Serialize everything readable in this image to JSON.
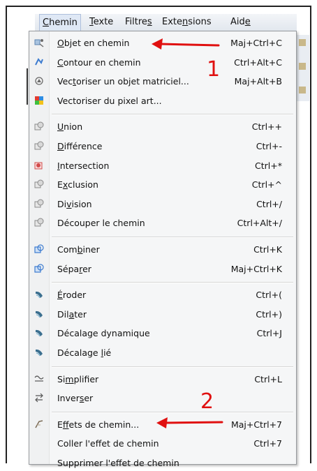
{
  "menubar": {
    "items": [
      {
        "label": "Chemin",
        "ul": 0
      },
      {
        "label": "Texte",
        "ul": 0
      },
      {
        "label": "Filtres",
        "ul": 6
      },
      {
        "label": "Extensions",
        "ul": 4
      },
      {
        "label": "Aide",
        "ul": 3
      }
    ]
  },
  "menu": {
    "items": [
      {
        "type": "item",
        "pre": "",
        "ul": "O",
        "post": "bjet en chemin",
        "acc": "Maj+Ctrl+C",
        "icon": "object-to-path-icon",
        "icolor": "#5b84b1"
      },
      {
        "type": "item",
        "pre": "",
        "ul": "C",
        "post": "ontour en chemin",
        "acc": "Ctrl+Alt+C",
        "icon": "stroke-to-path-icon",
        "icolor": "#3d7cd0"
      },
      {
        "type": "item",
        "pre": "Vec",
        "ul": "t",
        "post": "oriser un objet matriciel...",
        "acc": "Maj+Alt+B",
        "icon": "trace-bitmap-icon",
        "icolor": "#6a6a6a"
      },
      {
        "type": "item",
        "pre": "Vectoriser du pixel art...",
        "ul": "",
        "post": "",
        "acc": "",
        "icon": "trace-pixel-art-icon",
        "icolor": "#e23b2e"
      },
      {
        "type": "sep"
      },
      {
        "type": "item",
        "pre": "",
        "ul": "U",
        "post": "nion",
        "acc": "Ctrl++",
        "icon": "union-icon",
        "icolor": "#8a8a8a"
      },
      {
        "type": "item",
        "pre": "",
        "ul": "D",
        "post": "ifférence",
        "acc": "Ctrl+-",
        "icon": "difference-icon",
        "icolor": "#8a8a8a"
      },
      {
        "type": "item",
        "pre": "",
        "ul": "I",
        "post": "ntersection",
        "acc": "Ctrl+*",
        "icon": "intersection-icon",
        "icolor": "#d24b4b"
      },
      {
        "type": "item",
        "pre": "E",
        "ul": "x",
        "post": "clusion",
        "acc": "Ctrl+^",
        "icon": "exclusion-icon",
        "icolor": "#8a8a8a"
      },
      {
        "type": "item",
        "pre": "Di",
        "ul": "v",
        "post": "ision",
        "acc": "Ctrl+/",
        "icon": "division-icon",
        "icolor": "#8a8a8a"
      },
      {
        "type": "item",
        "pre": "Découper le chemin",
        "ul": "",
        "post": "",
        "acc": "Ctrl+Alt+/",
        "icon": "cut-path-icon",
        "icolor": "#8a8a8a"
      },
      {
        "type": "sep"
      },
      {
        "type": "item",
        "pre": "Com",
        "ul": "b",
        "post": "iner",
        "acc": "Ctrl+K",
        "icon": "combine-icon",
        "icolor": "#3d7cd0"
      },
      {
        "type": "item",
        "pre": "Sépa",
        "ul": "r",
        "post": "er",
        "acc": "Maj+Ctrl+K",
        "icon": "break-apart-icon",
        "icolor": "#3d7cd0"
      },
      {
        "type": "sep"
      },
      {
        "type": "item",
        "pre": "",
        "ul": "É",
        "post": "roder",
        "acc": "Ctrl+(",
        "icon": "inset-icon",
        "icolor": "#3b6f8f"
      },
      {
        "type": "item",
        "pre": "Dil",
        "ul": "a",
        "post": "ter",
        "acc": "Ctrl+)",
        "icon": "outset-icon",
        "icolor": "#3b6f8f"
      },
      {
        "type": "item",
        "pre": "Décalage dynamique",
        "ul": "",
        "post": "",
        "acc": "Ctrl+J",
        "icon": "dynamic-offset-icon",
        "icolor": "#3b6f8f"
      },
      {
        "type": "item",
        "pre": "Décalage ",
        "ul": "l",
        "post": "ié",
        "acc": "",
        "icon": "linked-offset-icon",
        "icolor": "#3b6f8f"
      },
      {
        "type": "sep"
      },
      {
        "type": "item",
        "pre": "Si",
        "ul": "m",
        "post": "plifier",
        "acc": "Ctrl+L",
        "icon": "simplify-icon",
        "icolor": "#555555"
      },
      {
        "type": "item",
        "pre": "Inver",
        "ul": "s",
        "post": "er",
        "acc": "",
        "icon": "reverse-icon",
        "icolor": "#555555"
      },
      {
        "type": "sep"
      },
      {
        "type": "item",
        "pre": "E",
        "ul": "f",
        "post": "fets de chemin...",
        "acc": "Maj+Ctrl+7",
        "icon": "path-effects-icon",
        "icolor": "#7a6a55"
      },
      {
        "type": "item",
        "pre": "Coller l'effet de chemin",
        "ul": "",
        "post": "",
        "acc": "Ctrl+7",
        "icon": "",
        "icolor": ""
      },
      {
        "type": "item",
        "pre": "Supprimer l'effet de chemin",
        "ul": "",
        "post": "",
        "acc": "",
        "icon": "",
        "icolor": ""
      }
    ]
  },
  "annotations": {
    "num1": "1",
    "num2": "2",
    "arrow_color": "#e01010"
  }
}
